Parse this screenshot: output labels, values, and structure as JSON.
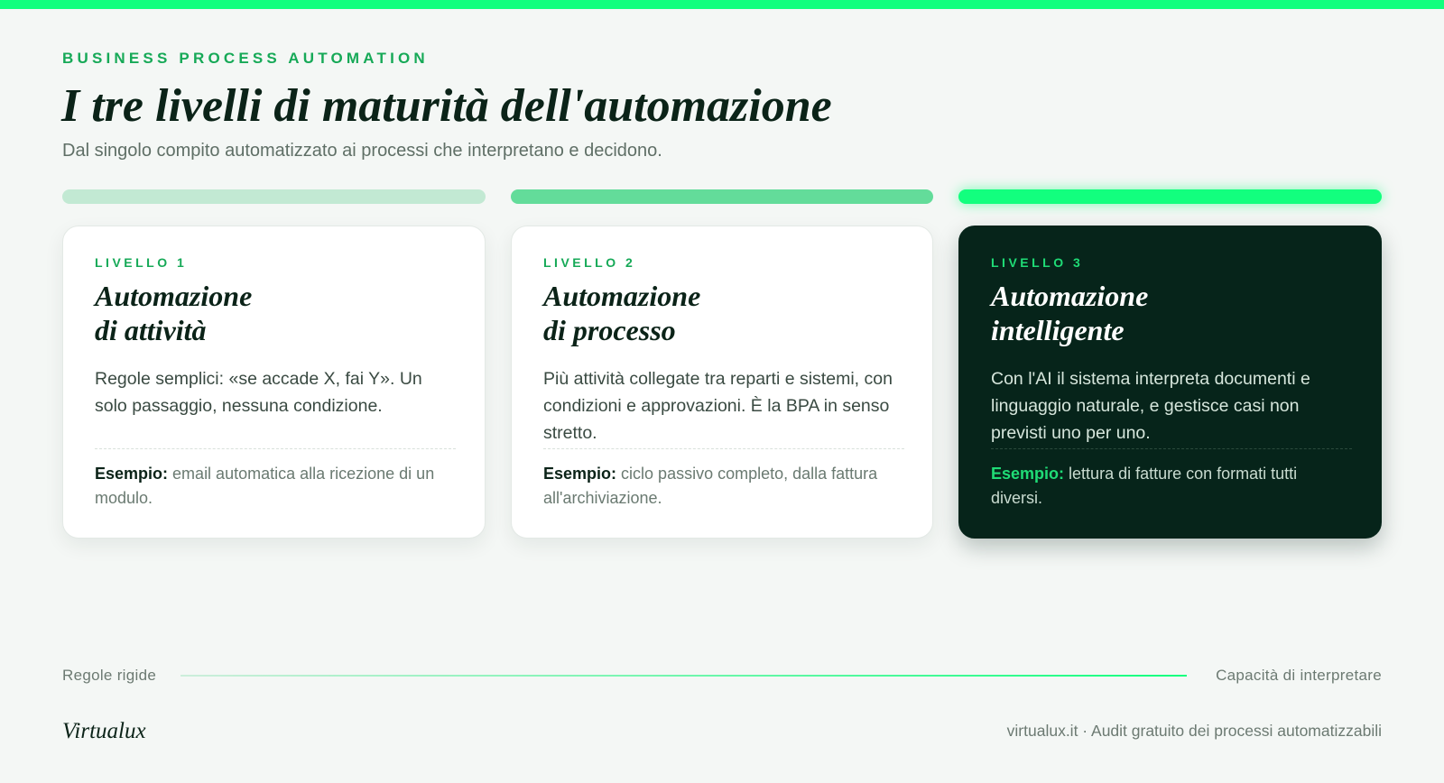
{
  "header": {
    "eyebrow": "BUSINESS PROCESS AUTOMATION",
    "title": "I tre livelli di maturità dell'automazione",
    "subtitle": "Dal singolo compito automatizzato ai processi che interpretano e decidono."
  },
  "levels": [
    {
      "label": "LIVELLO 1",
      "title_line1": "Automazione",
      "title_line2": "di attività",
      "description": "Regole semplici: «se accade X, fai Y». Un solo passaggio, nessuna condizione.",
      "example_label": "Esempio:",
      "example_text": "email automatica alla ricezione di un modulo.",
      "bar_color": "#c2e9d3"
    },
    {
      "label": "LIVELLO 2",
      "title_line1": "Automazione",
      "title_line2": "di processo",
      "description": "Più attività collegate tra reparti e sistemi, con condizioni e approvazioni. È la BPA in senso stretto.",
      "example_label": "Esempio:",
      "example_text": "ciclo passivo completo, dalla fattura all'archiviazione.",
      "bar_color": "#63dc9a"
    },
    {
      "label": "LIVELLO 3",
      "title_line1": "Automazione",
      "title_line2": "intelligente",
      "description": "Con l'AI il sistema interpreta documenti e linguaggio naturale, e gestisce casi non previsti uno per uno.",
      "example_label": "Esempio:",
      "example_text": "lettura di fatture con formati tutti diversi.",
      "bar_color": "#12ff7e"
    }
  ],
  "scale": {
    "left_label": "Regole rigide",
    "right_label": "Capacità di interpretare"
  },
  "footer": {
    "brand": "Virtualux",
    "note": "virtualux.it · Audit gratuito dei processi automatizzabili"
  },
  "colors": {
    "accent": "#12ff7e",
    "accent_text": "#16a957",
    "dark_card": "#06241a",
    "background": "#f4f7f5"
  }
}
